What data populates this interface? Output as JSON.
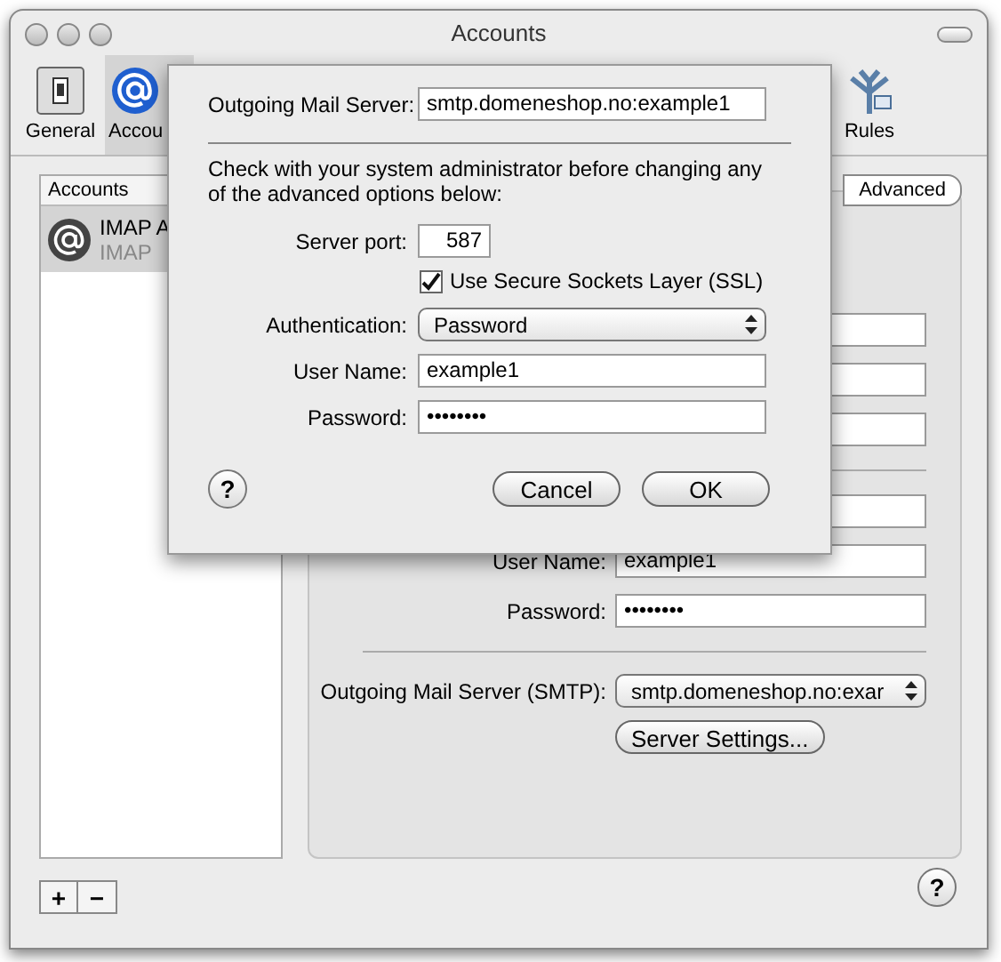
{
  "window": {
    "title": "Accounts"
  },
  "toolbar": {
    "items": [
      {
        "kind": "switch",
        "label": "General",
        "selected": false
      },
      {
        "kind": "at",
        "label": "Accou",
        "selected": true
      },
      {
        "kind": "rules",
        "label": "Rules",
        "selected": false
      }
    ]
  },
  "accounts_list": {
    "header": "Accounts",
    "items": [
      {
        "name": "IMAP A",
        "type": "IMAP",
        "selected": true
      }
    ]
  },
  "tabs": [
    {
      "label": "Advanced",
      "selected": false
    }
  ],
  "account_form": {
    "user_name": {
      "label": "User Name:",
      "value": "example1"
    },
    "password": {
      "label": "Password:",
      "value": "••••••••"
    },
    "smtp": {
      "label": "Outgoing Mail Server (SMTP):",
      "value": "smtp.domeneshop.no:exar"
    },
    "server_settings": "Server Settings..."
  },
  "sheet": {
    "outgoing_server": {
      "label": "Outgoing Mail Server:",
      "value": "smtp.domeneshop.no:example1"
    },
    "notice": "Check with your system administrator before changing any of the advanced options below:",
    "server_port": {
      "label": "Server port:",
      "value": "587"
    },
    "ssl": {
      "label": "Use Secure Sockets Layer (SSL)",
      "checked": true
    },
    "authentication": {
      "label": "Authentication:",
      "value": "Password"
    },
    "user_name": {
      "label": "User Name:",
      "value": "example1"
    },
    "password": {
      "label": "Password:",
      "value": "••••••••"
    },
    "help": "?",
    "buttons": [
      "Cancel",
      "OK"
    ]
  },
  "bottom": {
    "add": "+",
    "remove": "−",
    "help": "?"
  }
}
